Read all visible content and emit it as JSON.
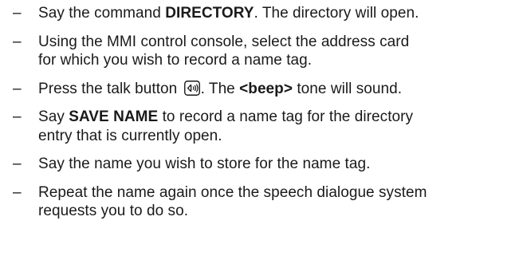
{
  "steps": [
    {
      "dash": "–",
      "pre": "Say the command ",
      "bold": "DIRECTORY",
      "post": ". The directory will open."
    },
    {
      "dash": "–",
      "line1": "Using the MMI control console, select the address card",
      "line2": "for which you wish to record a name tag."
    },
    {
      "dash": "–",
      "pre": "Press the talk button ",
      "icon": "talk-button-icon",
      "mid": ". The ",
      "bold": "<beep>",
      "post": " tone will sound."
    },
    {
      "dash": "–",
      "pre": "Say ",
      "bold": "SAVE NAME",
      "post": " to record a name tag for the directory",
      "line2": "entry that is currently open."
    },
    {
      "dash": "–",
      "text": "Say the name you wish to store for the name tag."
    },
    {
      "dash": "–",
      "line1": "Repeat the name again once the speech dialogue system",
      "line2": "requests you to do so."
    }
  ]
}
